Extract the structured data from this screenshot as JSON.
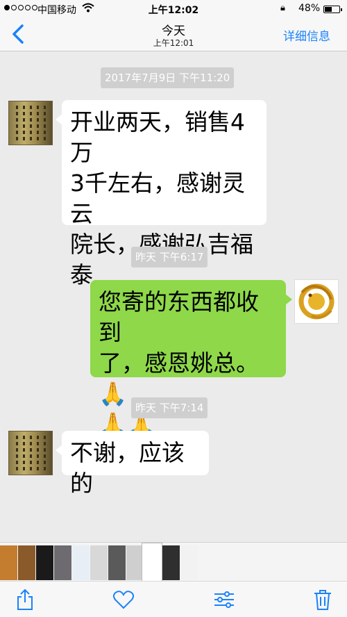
{
  "status_bar": {
    "carrier": "中国移动",
    "time": "上午12:02",
    "battery_text": "48%",
    "battery_level": 0.48,
    "signal_bars_filled": 1,
    "signal_bars_total": 5
  },
  "nav": {
    "back_icon": "chevron-left-icon",
    "title": "今天",
    "subtitle": "上午12:01",
    "details_label": "详细信息",
    "accent_color": "#1a82fb"
  },
  "messages": [
    {
      "type": "timestamp",
      "text": "2017年7月9日 下午11:20"
    },
    {
      "type": "incoming",
      "lines": [
        "开业两天，销售4万",
        "3千左右，感谢灵云",
        "院长，感谢弘吉福",
        "泰"
      ]
    },
    {
      "type": "timestamp",
      "text": "昨天 下午6:17"
    },
    {
      "type": "outgoing",
      "lines": [
        "您寄的东西都收到",
        "了，感恩姚总。🙏",
        "🙏🙏"
      ]
    },
    {
      "type": "timestamp",
      "text": "昨天 下午7:14"
    },
    {
      "type": "incoming",
      "lines": [
        "不谢，应该的"
      ]
    }
  ],
  "colors": {
    "background": "#ebebeb",
    "incoming_bubble": "#ffffff",
    "outgoing_bubble": "#8ed84a",
    "timestamp_pill": "#cfcfcf"
  },
  "thumbnail_strip": {
    "count": 10,
    "thumb_colors": [
      "#c47d2e",
      "#8a5a2a",
      "#1a1a1a",
      "#6d6a70",
      "#e8eef6",
      "#d8d8d8",
      "#5a5a5a",
      "#cfcfcf",
      "#2f2f2f",
      "#f2f2f2"
    ]
  },
  "toolbar": {
    "icons": [
      "share-icon",
      "heart-icon",
      "sliders-icon",
      "trash-icon"
    ]
  }
}
